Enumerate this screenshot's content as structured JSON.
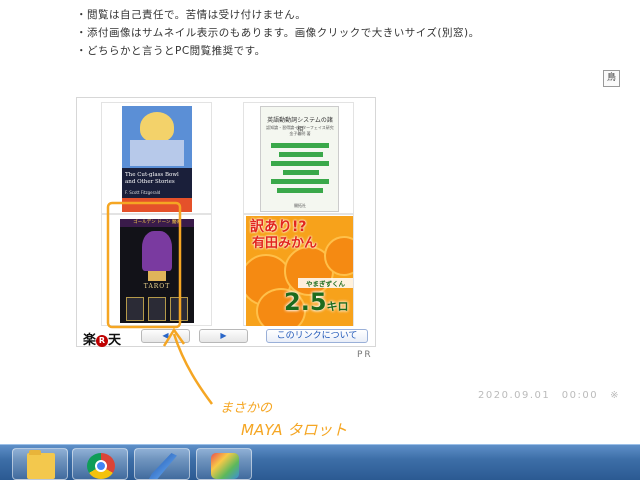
{
  "notes": [
    "・閲覧は自己責任で。苦情は受け付けません。",
    "・添付画像はサムネイル表示のもあります。画像クリックで大きいサイズ(別窓)。",
    "・どちらかと言うとPC閲覧推奨です。"
  ],
  "corner_icon": "鳥",
  "widget": {
    "products": [
      {
        "title": "The Cut-glass Bowl and Other Stories",
        "author": "F. Scott Fitzgerald"
      },
      {
        "title": "英語動動詞システムの諸相",
        "subtitle": "認知論・習得論インターフェイス研究",
        "author": "金子義明 著",
        "publisher": "開拓社"
      },
      {
        "header": "ゴールデン ドーン 魔術",
        "title": "TAROT"
      },
      {
        "headline": "訳あり!?",
        "name": "有田みかん",
        "label": "やまぎずくん",
        "weight": "2.5",
        "unit": "キロ"
      }
    ],
    "logo_text": "楽",
    "logo_r": "R",
    "logo_text2": "天",
    "prev_label": "◀",
    "next_label": "▶",
    "about_label": "このリンクについて"
  },
  "pr": "PR",
  "timestamp": "2020.09.01　00:00",
  "timestamp_mark": "※",
  "annotation": {
    "line1": "まさかの",
    "line2": "MAYA タロット",
    "color": "#f5a623"
  },
  "taskbar": {
    "apps": [
      "folder-icon",
      "chrome-icon",
      "feather-icon",
      "paint-icon"
    ]
  }
}
